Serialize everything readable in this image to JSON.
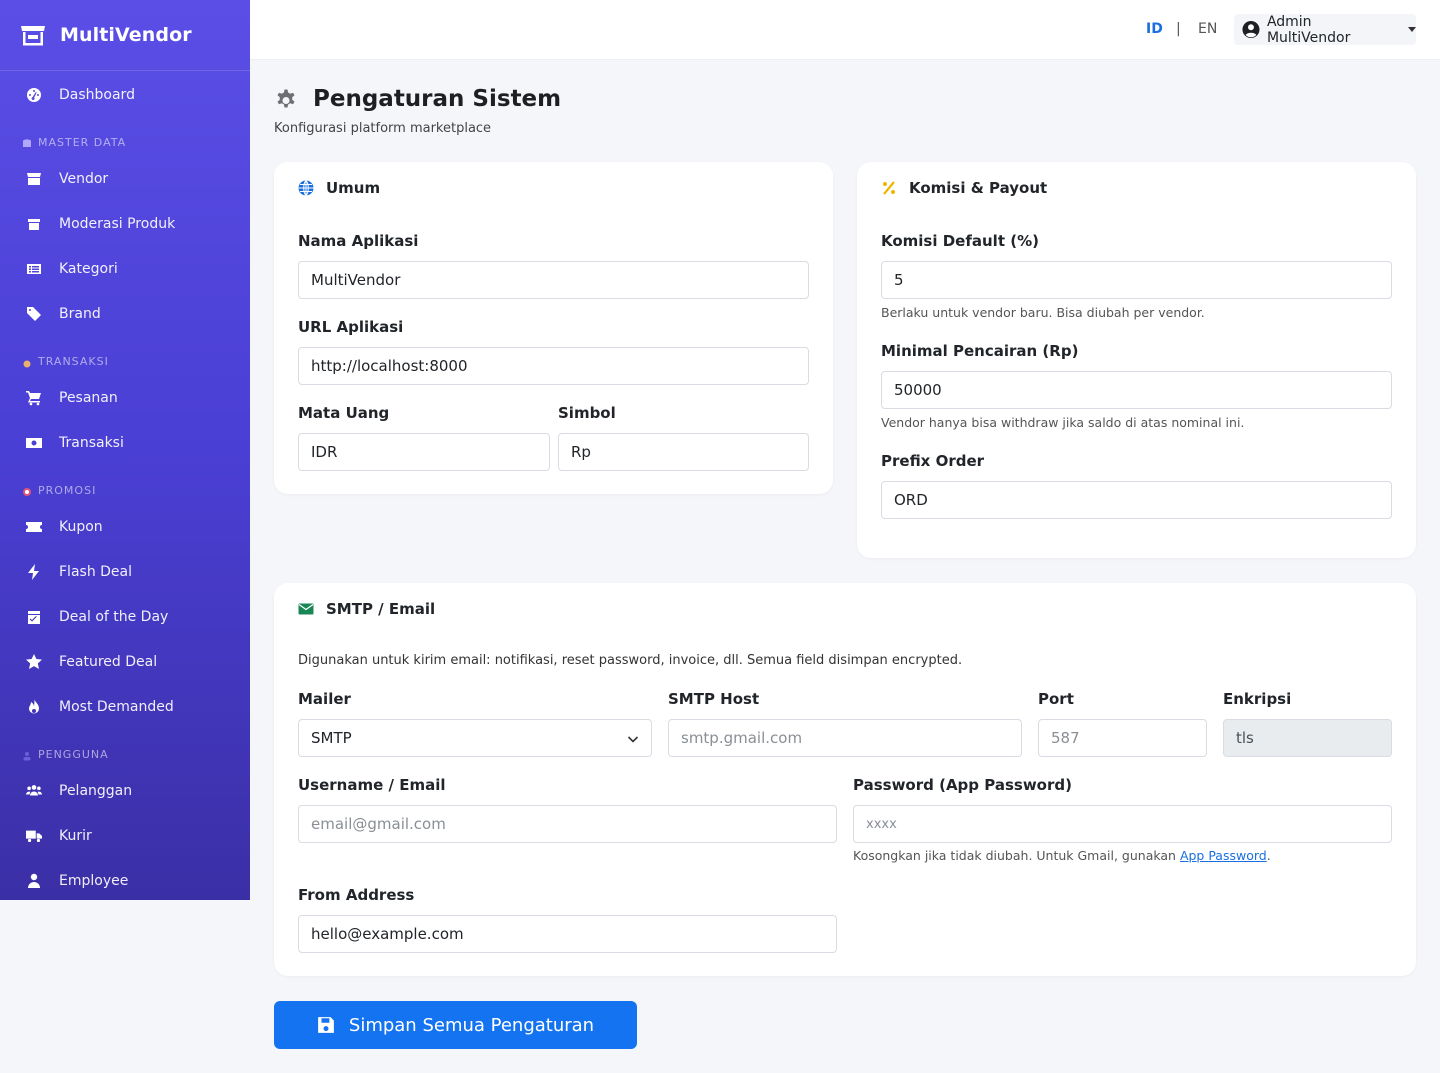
{
  "brand": {
    "name": "MultiVendor"
  },
  "sidebar": {
    "dashboard": "Dashboard",
    "section_master": "MASTER DATA",
    "vendor": "Vendor",
    "moderasi": "Moderasi Produk",
    "kategori": "Kategori",
    "brand": "Brand",
    "section_transaksi": "TRANSAKSI",
    "pesanan": "Pesanan",
    "transaksi": "Transaksi",
    "section_promosi": "PROMOSI",
    "kupon": "Kupon",
    "flash": "Flash Deal",
    "dotd": "Deal of the Day",
    "featured": "Featured Deal",
    "most": "Most Demanded",
    "section_pengguna": "PENGGUNA",
    "pelanggan": "Pelanggan",
    "kurir": "Kurir",
    "employee": "Employee"
  },
  "topbar": {
    "lang_id": "ID",
    "sep": "|",
    "lang_en": "EN",
    "user": "Admin MultiVendor"
  },
  "page": {
    "title": "Pengaturan Sistem",
    "subtitle": "Konfigurasi platform marketplace"
  },
  "umum": {
    "title": "Umum",
    "nama_label": "Nama Aplikasi",
    "nama_value": "MultiVendor",
    "url_label": "URL Aplikasi",
    "url_value": "http://localhost:8000",
    "mata_label": "Mata Uang",
    "mata_value": "IDR",
    "simbol_label": "Simbol",
    "simbol_value": "Rp"
  },
  "komisi": {
    "title": "Komisi & Payout",
    "default_label": "Komisi Default (%)",
    "default_value": "5",
    "default_help": "Berlaku untuk vendor baru. Bisa diubah per vendor.",
    "min_label": "Minimal Pencairan (Rp)",
    "min_value": "50000",
    "min_help": "Vendor hanya bisa withdraw jika saldo di atas nominal ini.",
    "prefix_label": "Prefix Order",
    "prefix_value": "ORD"
  },
  "smtp": {
    "title": "SMTP / Email",
    "desc": "Digunakan untuk kirim email: notifikasi, reset password, invoice, dll. Semua field disimpan encrypted.",
    "mailer_label": "Mailer",
    "mailer_value": "SMTP",
    "host_label": "SMTP Host",
    "host_placeholder": "smtp.gmail.com",
    "port_label": "Port",
    "port_value": "587",
    "enc_label": "Enkripsi",
    "enc_value": "tls",
    "user_label": "Username / Email",
    "user_placeholder": "email@gmail.com",
    "pass_label": "Password (App Password)",
    "pass_placeholder": "xxxx",
    "pass_help_prefix": "Kosongkan jika tidak diubah. Untuk Gmail, gunakan ",
    "pass_help_link": "App Password",
    "pass_help_suffix": ".",
    "from_label": "From Address",
    "from_value": "hello@example.com"
  },
  "save_label": "Simpan Semua Pengaturan",
  "colors": {
    "primary": "#1473f0",
    "sidebar_top": "#5a4ee6",
    "sidebar_bottom": "#3b2fa6"
  }
}
